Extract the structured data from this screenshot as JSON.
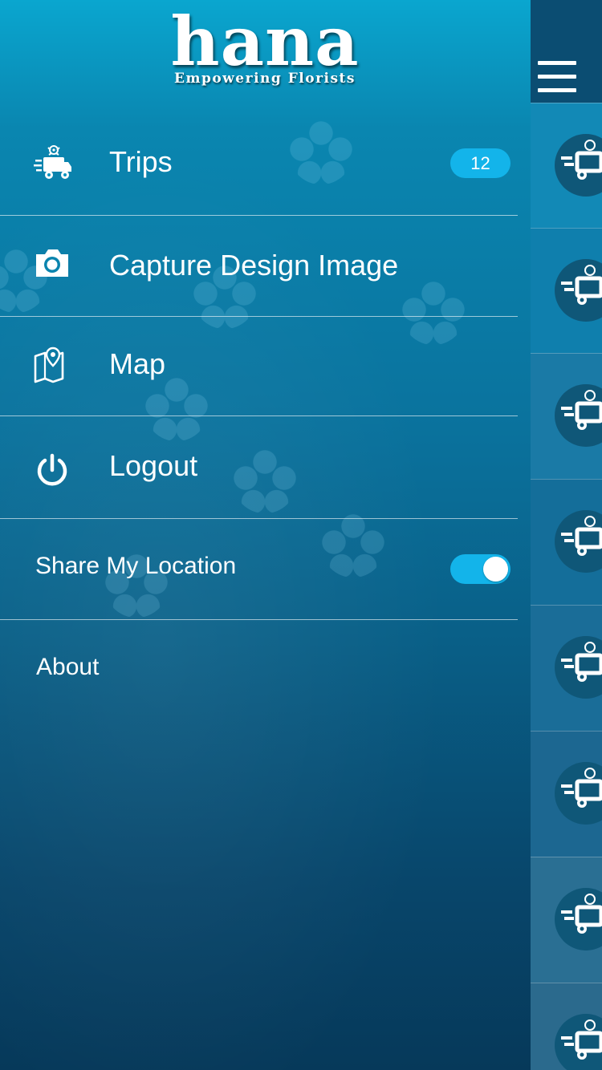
{
  "app": {
    "logo_word": "hana",
    "logo_tagline": "Empowering Florists"
  },
  "menu": {
    "trips": {
      "label": "Trips",
      "badge": "12",
      "icon": "delivery-truck-icon"
    },
    "capture": {
      "label": "Capture Design Image",
      "icon": "camera-icon"
    },
    "map": {
      "label": "Map",
      "icon": "map-pin-icon"
    },
    "logout": {
      "label": "Logout",
      "icon": "power-icon"
    }
  },
  "share_location": {
    "label": "Share My Location",
    "enabled": true
  },
  "about": {
    "label": "About"
  },
  "colors": {
    "accent": "#13b4ea",
    "drawer_top": "#0aa6cf",
    "drawer_bottom": "#06395a"
  },
  "background_list": {
    "row_icon": "delivery-truck-icon",
    "visible_rows": 8
  }
}
